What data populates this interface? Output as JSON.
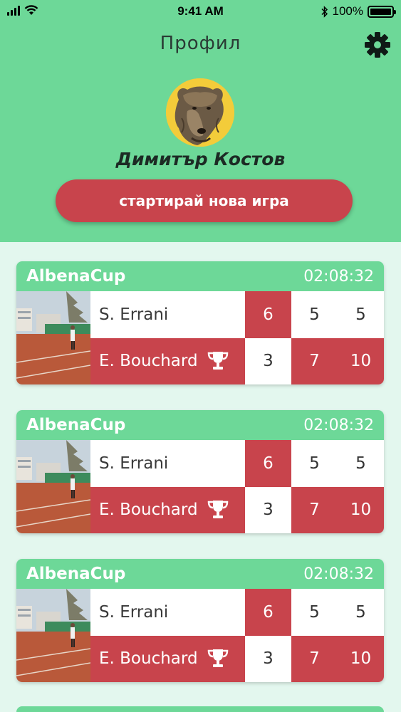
{
  "status_bar": {
    "time": "9:41 AM",
    "battery": "100%"
  },
  "header": {
    "title": "Профил",
    "user_name": "Димитър Костов",
    "new_game_label": "стартирай нова игра"
  },
  "matches": [
    {
      "tournament": "AlbenaCup",
      "time": "02:08:32",
      "players": [
        {
          "name": "S. Errani",
          "scores": [
            "6",
            "5",
            "5"
          ]
        },
        {
          "name": "E. Bouchard",
          "scores": [
            "3",
            "7",
            "10"
          ]
        }
      ]
    },
    {
      "tournament": "AlbenaCup",
      "time": "02:08:32",
      "players": [
        {
          "name": "S. Errani",
          "scores": [
            "6",
            "5",
            "5"
          ]
        },
        {
          "name": "E. Bouchard",
          "scores": [
            "3",
            "7",
            "10"
          ]
        }
      ]
    },
    {
      "tournament": "AlbenaCup",
      "time": "02:08:32",
      "players": [
        {
          "name": "S. Errani",
          "scores": [
            "6",
            "5",
            "5"
          ]
        },
        {
          "name": "E. Bouchard",
          "scores": [
            "3",
            "7",
            "10"
          ]
        }
      ]
    }
  ],
  "colors": {
    "accent_green": "#6dd898",
    "accent_red": "#c8444c",
    "background": "#e3f7ee"
  }
}
